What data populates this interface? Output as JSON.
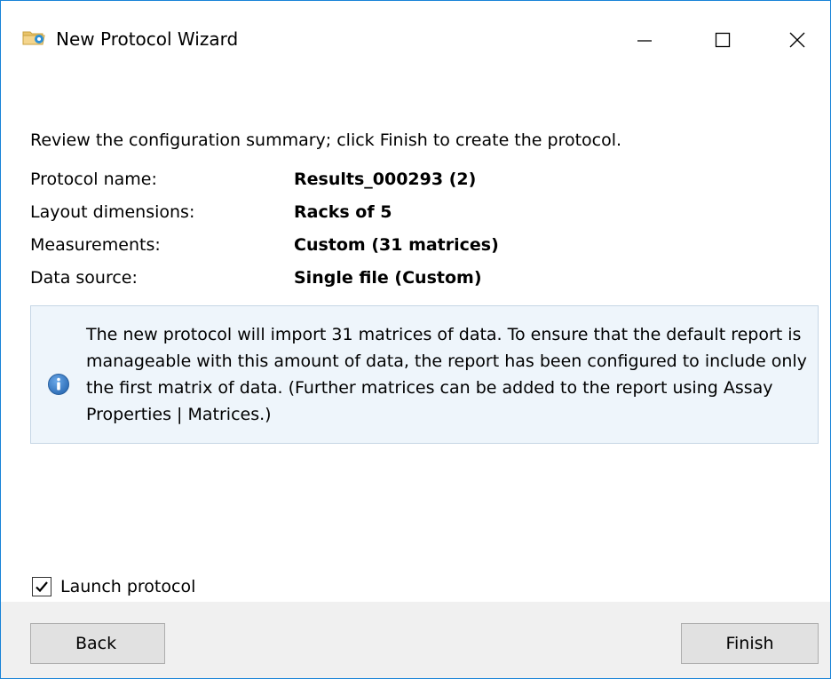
{
  "window": {
    "title": "New Protocol Wizard",
    "icons": {
      "app": "protocol-wizard-icon",
      "minimize": "minimize-icon",
      "maximize": "maximize-icon",
      "close": "close-icon"
    }
  },
  "intro": "Review the configuration summary; click Finish to create the protocol.",
  "summary": [
    {
      "label": "Protocol name:",
      "value": "Results_000293 (2)"
    },
    {
      "label": "Layout dimensions:",
      "value": "Racks of 5"
    },
    {
      "label": "Measurements:",
      "value": "Custom (31 matrices)"
    },
    {
      "label": "Data source:",
      "value": "Single file (Custom)"
    }
  ],
  "info": {
    "icon": "info-icon",
    "text": "The new protocol will import 31 matrices of data. To ensure that the default report is manageable with this amount of data, the report has been configured to include only the first matrix of data. (Further matrices can be added to the report using Assay Properties | Matrices.)"
  },
  "launch": {
    "label": "Launch protocol",
    "checked": true
  },
  "buttons": {
    "back": "Back",
    "finish": "Finish"
  },
  "colors": {
    "window_border": "#1883d7",
    "info_bg": "#eef5fb",
    "info_icon": "#2f6fb8",
    "footer_bg": "#f0f0f0"
  }
}
